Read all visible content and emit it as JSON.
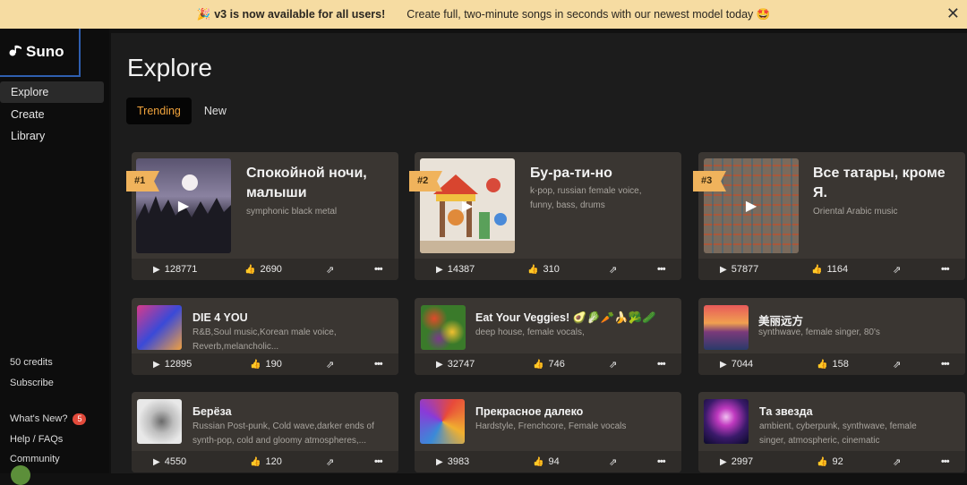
{
  "banner": {
    "emoji_left": "🎉",
    "bold": "v3 is now available for all users!",
    "text": "Create full, two-minute songs in seconds with our newest model today 🤩",
    "close": "✕"
  },
  "sidebar": {
    "logo": "Suno",
    "nav": [
      {
        "label": "Explore"
      },
      {
        "label": "Create"
      },
      {
        "label": "Library"
      }
    ],
    "credits": "50 credits",
    "subscribe": "Subscribe",
    "whats_new": "What's New?",
    "whats_new_count": "5",
    "help": "Help / FAQs",
    "community": "Community"
  },
  "main": {
    "title": "Explore",
    "tabs": [
      {
        "label": "Trending"
      },
      {
        "label": "New"
      }
    ]
  },
  "trending": [
    {
      "rank": "#1",
      "title": "Спокойной ночи, малыши",
      "tags": "symphonic black metal",
      "plays": "128771",
      "likes": "2690",
      "thumb": "moon-forest"
    },
    {
      "rank": "#2",
      "title": "Бу-ра-ти-но",
      "tags": "k-pop, russian female voice, funny, bass, drums",
      "plays": "14387",
      "likes": "310",
      "thumb": "carnival"
    },
    {
      "rank": "#3",
      "title": "Все татары, кроме Я.",
      "tags": "Oriental Arabic music",
      "plays": "57877",
      "likes": "1164",
      "thumb": "mosaic"
    }
  ],
  "songs": [
    {
      "title": "DIE 4 YOU",
      "tags": "R&B,Soul music,Korean male voice, Reverb,melancholic...",
      "plays": "12895",
      "likes": "190",
      "thumb": "kiss"
    },
    {
      "title": "Eat Your Veggies! 🥑🥬🥕🍌🥦🥒",
      "tags": "deep house, female vocals,",
      "plays": "32747",
      "likes": "746",
      "thumb": "veggies"
    },
    {
      "title": "美丽远方",
      "tags": "synthwave, female singer, 80's",
      "plays": "7044",
      "likes": "158",
      "thumb": "sunset"
    },
    {
      "title": "Берёза",
      "tags": "Russian Post-punk, Cold wave,darker ends of synth-pop, cold and gloomy atmospheres,...",
      "plays": "4550",
      "likes": "120",
      "thumb": "bird"
    },
    {
      "title": "Прекрасное далеко",
      "tags": "Hardstyle, Frenchcore, Female vocals",
      "plays": "3983",
      "likes": "94",
      "thumb": "swirl"
    },
    {
      "title": "Та звезда",
      "tags": "ambient, cyberpunk, synthwave, female singer, atmospheric, cinematic",
      "plays": "2997",
      "likes": "92",
      "thumb": "star"
    }
  ],
  "icons": {
    "play": "▶",
    "like": "👍",
    "share": "⇗",
    "more": "•••"
  },
  "colors": {
    "accent": "#f0a33c",
    "banner": "#f6dca2",
    "card": "#3a3632"
  }
}
